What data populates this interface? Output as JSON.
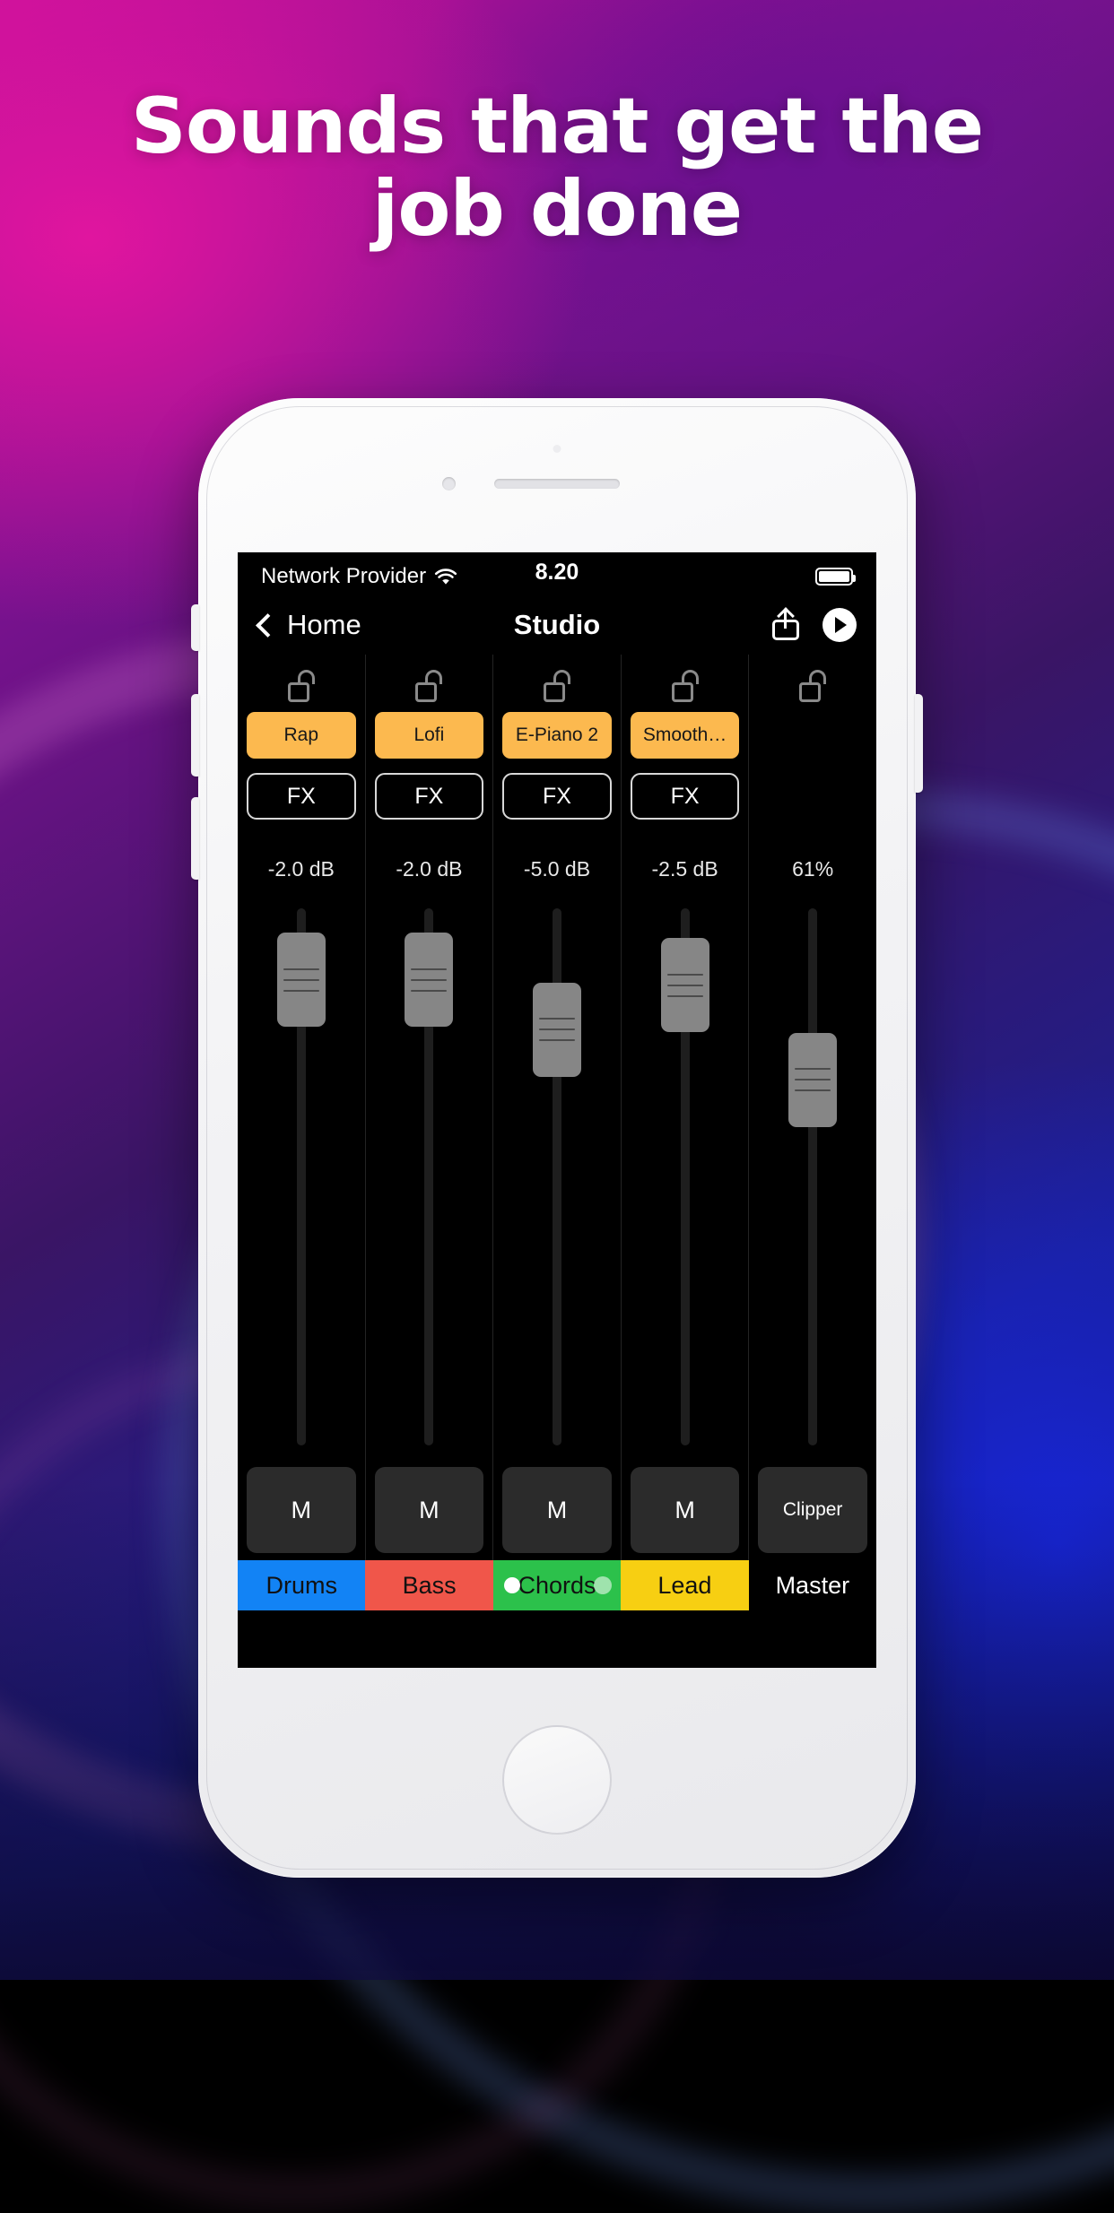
{
  "promo": {
    "headline_line1": "Sounds that get the",
    "headline_line2": "job done"
  },
  "phone": {
    "status_bar": {
      "carrier": "Network Provider",
      "wifi_icon": "wifi-icon",
      "time": "8.20",
      "battery_icon": "battery-full-icon"
    },
    "nav_bar": {
      "back_label": "Home",
      "back_icon": "chevron-left-icon",
      "title": "Studio",
      "share_icon": "share-icon",
      "play_icon": "play-icon"
    },
    "mixer": {
      "lock_icon": "unlock-icon",
      "channels": [
        {
          "name": "Drums",
          "color": "#1283f5",
          "lock_state": "unlocked",
          "preset": "Rap",
          "fx_label": "FX",
          "level": "-2.0 dB",
          "fader_position_pct": 72,
          "mute_label": "M"
        },
        {
          "name": "Bass",
          "color": "#f0564a",
          "lock_state": "unlocked",
          "preset": "Lofi",
          "fx_label": "FX",
          "level": "-2.0 dB",
          "fader_position_pct": 72,
          "mute_label": "M"
        },
        {
          "name": "Chords",
          "color": "#2cc14b",
          "lock_state": "unlocked",
          "preset": "E-Piano 2",
          "fx_label": "FX",
          "level": "-5.0 dB",
          "fader_position_pct": 63,
          "mute_label": "M"
        },
        {
          "name": "Lead",
          "color": "#f7cf12",
          "lock_state": "unlocked",
          "preset": "Smooth…",
          "fx_label": "FX",
          "level": "-2.5 dB",
          "fader_position_pct": 72,
          "mute_label": "M"
        },
        {
          "name": "Master",
          "color": "#000000",
          "lock_state": "unlocked",
          "preset": null,
          "fx_label": null,
          "level": "61%",
          "fader_position_pct": 55,
          "mute_label": "Clipper"
        }
      ]
    }
  },
  "colors": {
    "preset_orange": "#fcb94f",
    "mute_gray": "#2b2b2b",
    "fader_handle": "#868686",
    "screen_bg": "#000000"
  }
}
